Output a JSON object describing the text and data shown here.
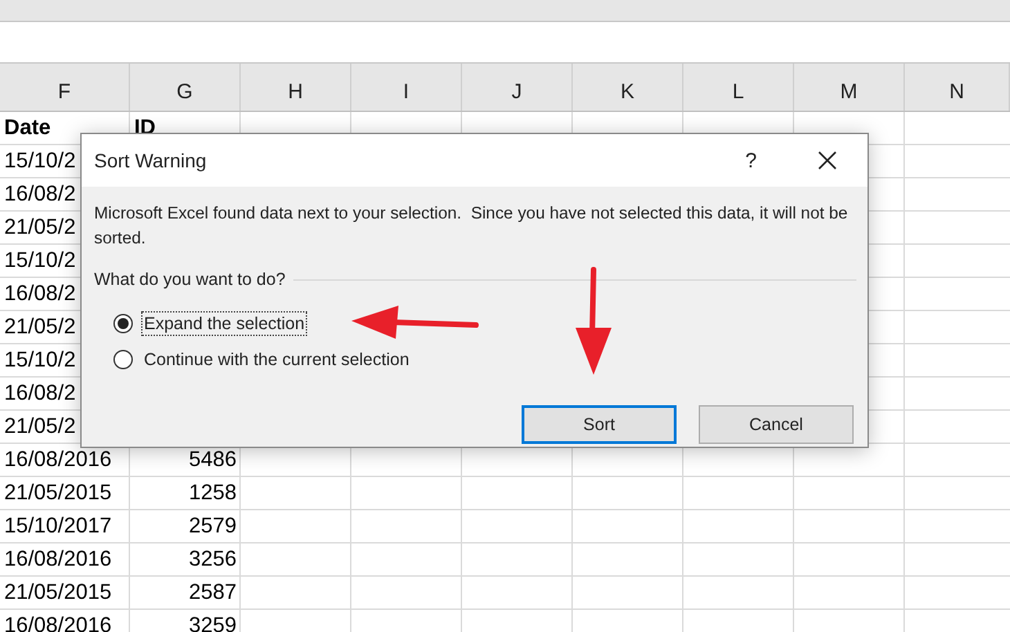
{
  "columns": [
    "F",
    "G",
    "H",
    "I",
    "J",
    "K",
    "L",
    "M",
    "N"
  ],
  "rows": [
    {
      "kind": "header",
      "date": "Date",
      "id": "ID"
    },
    {
      "kind": "data",
      "date": "15/10/2"
    },
    {
      "kind": "data",
      "date": "16/08/2"
    },
    {
      "kind": "data",
      "date": "21/05/2"
    },
    {
      "kind": "data",
      "date": "15/10/2"
    },
    {
      "kind": "data",
      "date": "16/08/2"
    },
    {
      "kind": "data",
      "date": "21/05/2"
    },
    {
      "kind": "data",
      "date": "15/10/2"
    },
    {
      "kind": "data",
      "date": "16/08/2"
    },
    {
      "kind": "data",
      "date": "21/05/2"
    },
    {
      "kind": "data",
      "date": "16/08/2016",
      "id": "5486"
    },
    {
      "kind": "data",
      "date": "21/05/2015",
      "id": "1258"
    },
    {
      "kind": "data",
      "date": "15/10/2017",
      "id": "2579"
    },
    {
      "kind": "data",
      "date": "16/08/2016",
      "id": "3256"
    },
    {
      "kind": "data",
      "date": "21/05/2015",
      "id": "2587"
    },
    {
      "kind": "data",
      "date": "16/08/2016",
      "id": "3259"
    }
  ],
  "dialog": {
    "title": "Sort Warning",
    "help": "?",
    "message": "Microsoft Excel found data next to your selection.  Since you have not selected this data, it will not be sorted.",
    "question": "What do you want to do?",
    "options": [
      {
        "label": "Expand the selection",
        "selected": true,
        "focused": true
      },
      {
        "label": "Continue with the current selection",
        "selected": false,
        "focused": false
      }
    ],
    "buttons": [
      {
        "label": "Sort",
        "default": true
      },
      {
        "label": "Cancel",
        "default": false
      }
    ]
  }
}
